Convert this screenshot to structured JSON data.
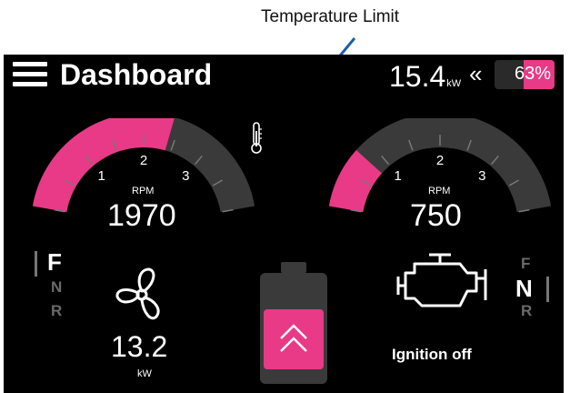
{
  "annotation": {
    "label": "Temperature Limit"
  },
  "header": {
    "title": "Dashboard",
    "power_value": "15.4",
    "power_unit": "kW",
    "chevron": "«",
    "battery_percent": "63%"
  },
  "gauges": [
    {
      "label": "RPM",
      "value": "1970",
      "ticks": [
        "1",
        "2",
        "3"
      ],
      "level": 0.6
    },
    {
      "label": "RPM",
      "value": "750",
      "ticks": [
        "1",
        "2",
        "3"
      ],
      "level": 0.2
    }
  ],
  "left_panel": {
    "gears": [
      "F",
      "N",
      "R"
    ],
    "active_gear": "F",
    "power": "13.2",
    "unit": "kW"
  },
  "right_panel": {
    "gears": [
      "F",
      "N",
      "R"
    ],
    "active_gear": "N",
    "status": "Ignition off"
  },
  "icons": [
    "menu-icon",
    "thermometer-icon",
    "propeller-icon",
    "engine-icon",
    "battery-icon",
    "chevron-up-icon"
  ],
  "colors": {
    "accent": "#e83a86",
    "background": "#000000",
    "track": "#3a3a3a",
    "text": "#ffffff"
  }
}
